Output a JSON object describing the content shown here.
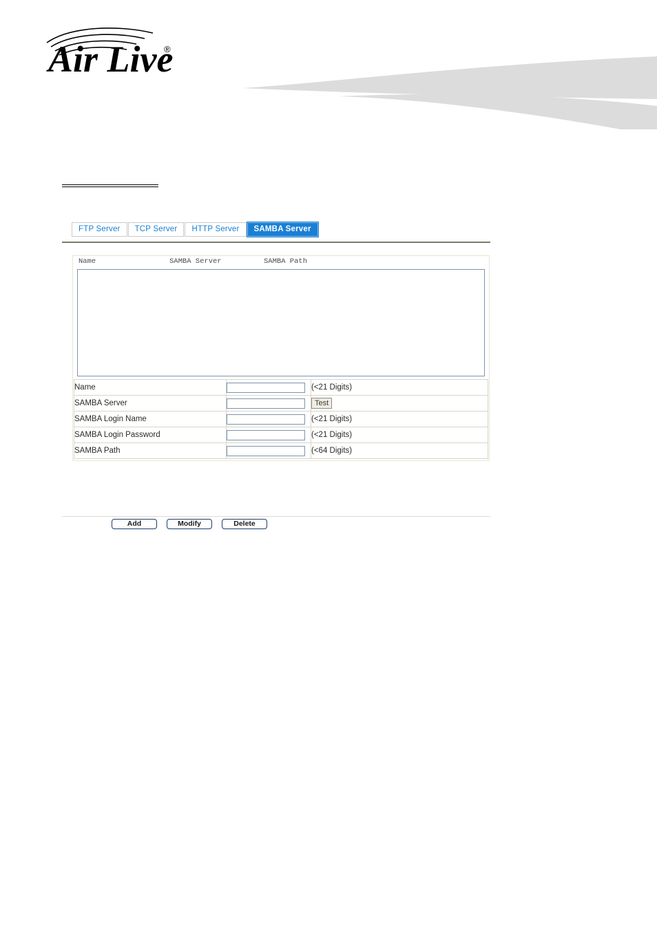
{
  "header": {
    "logo_text": "Air Live",
    "logo_trademark": "®",
    "logo_icon": "wireless-signal-arcs",
    "accent_color": "#1a7fd4",
    "swoosh_color": "#dcdcdc"
  },
  "tabs": [
    {
      "label": "FTP Server",
      "active": false
    },
    {
      "label": "TCP Server",
      "active": false
    },
    {
      "label": "HTTP Server",
      "active": false
    },
    {
      "label": "SAMBA Server",
      "active": true
    }
  ],
  "list": {
    "columns": [
      "Name",
      "SAMBA Server",
      "SAMBA Path"
    ],
    "rows": []
  },
  "form": {
    "rows": [
      {
        "label": "Name",
        "value": "",
        "hint": "(<21 Digits)",
        "button": null
      },
      {
        "label": "SAMBA Server",
        "value": "",
        "hint": "",
        "button": "Test"
      },
      {
        "label": "SAMBA Login Name",
        "value": "",
        "hint": "(<21 Digits)",
        "button": null
      },
      {
        "label": "SAMBA Login Password",
        "value": "",
        "hint": "(<21 Digits)",
        "button": null
      },
      {
        "label": "SAMBA Path",
        "value": "",
        "hint": "(<64 Digits)",
        "button": null
      }
    ]
  },
  "actions": [
    {
      "label": "Add"
    },
    {
      "label": "Modify"
    },
    {
      "label": "Delete"
    }
  ]
}
